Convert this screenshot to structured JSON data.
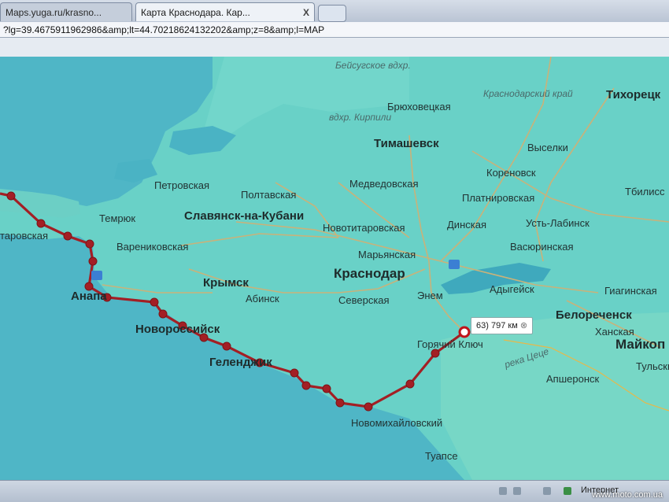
{
  "browser": {
    "tabs": [
      {
        "label": "Maps.yuga.ru/krasno..."
      },
      {
        "label": "Карта Краснодара. Кар..."
      }
    ],
    "tab_close": "X",
    "address": "?lg=39.4675911962986&amp;lt=44.70218624132202&amp;z=8&amp;l=MAP"
  },
  "map": {
    "labels": {
      "beisugskoe": "Бейсугское вдхр.",
      "bryukhovetskaya": "Брюховецкая",
      "krasnodarsky_krai": "Краснодарский край",
      "tikhoretsk": "Тихорецк",
      "kirpili": "вдхр. Кирпили",
      "timashevsk": "Тимашевск",
      "viselki": "Выселки",
      "korenovsk": "Кореновск",
      "petrovskaya": "Петровская",
      "poltavskaya": "Полтавская",
      "medvedovskaya": "Медведовская",
      "platnirovskaya": "Платнировская",
      "tbilisskaya": "Тбилисс",
      "temryuk": "Темрюк",
      "slavyansk": "Славянск-на-Кубани",
      "novotitarovskaya": "Новотитаровская",
      "dinskaya": "Динская",
      "ust_labinsk": "Усть-Лабинск",
      "taman": "таровская",
      "varenikovskaya": "Варениковская",
      "maryanskaya": "Марьянская",
      "vasyurinskaya": "Васюринская",
      "krymsk": "Крымск",
      "krasnodar": "Краснодар",
      "adygeysk": "Адыгейск",
      "giaginskaya": "Гиагинская",
      "anapa": "Анапа",
      "abinsk": "Абинск",
      "severskaya": "Северская",
      "enem": "Энем",
      "belorechensk": "Белореченск",
      "novorossiysk": "Новороссийск",
      "khanskaya": "Ханская",
      "maykop": "Майкоп",
      "goryachy_klyuch": "Горячий Ключ",
      "tsetse": "река Цеце",
      "gelendzhik": "Геленджик",
      "tulskiy": "Тульский",
      "apsheronsk": "Апшеронск",
      "novomikhaylovsky": "Новомихайловский",
      "tuapse": "Туапсе"
    },
    "distance_marker": {
      "index": "63)",
      "distance": "797 км"
    }
  },
  "statusbar": {
    "zone": "Интернет",
    "watermark": "www.moto.com.ua"
  }
}
